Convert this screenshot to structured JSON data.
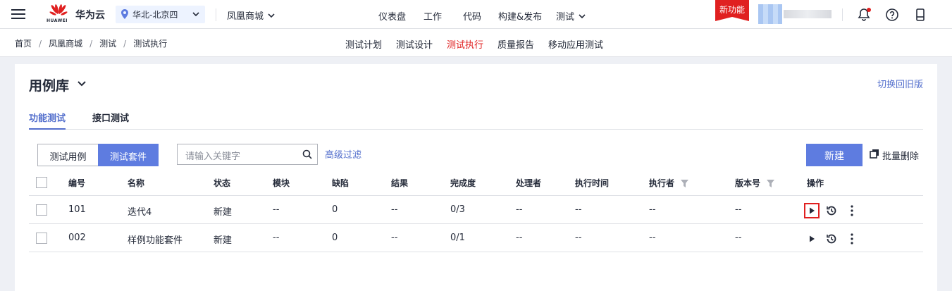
{
  "header": {
    "logo_text": "HUAWEI",
    "brand": "华为云",
    "region": "华北-北京四",
    "project": "凤凰商城",
    "nav": [
      "仪表盘",
      "工作",
      "代码",
      "构建&发布",
      "测试"
    ],
    "new_feature": "新功能"
  },
  "subheader": {
    "breadcrumb": [
      "首页",
      "凤凰商城",
      "测试",
      "测试执行"
    ],
    "tabs": [
      "测试计划",
      "测试设计",
      "测试执行",
      "质量报告",
      "移动应用测试"
    ],
    "active_tab": "测试执行"
  },
  "page": {
    "title": "用例库",
    "switch_old": "切换回旧版",
    "tabs": [
      "功能测试",
      "接口测试"
    ],
    "segment": [
      "测试用例",
      "测试套件"
    ],
    "search_placeholder": "请输入关键字",
    "advanced_filter": "高级过滤",
    "new_button": "新建",
    "bulk_delete": "批量删除"
  },
  "table": {
    "columns": [
      "编号",
      "名称",
      "状态",
      "模块",
      "缺陷",
      "结果",
      "完成度",
      "处理者",
      "执行时间",
      "执行者",
      "版本号",
      "操作"
    ],
    "rows": [
      [
        "101",
        "迭代4",
        "新建",
        "--",
        "0",
        "--",
        "0/3",
        "--",
        "--",
        "--",
        "--"
      ],
      [
        "002",
        "样例功能套件",
        "新建",
        "--",
        "0",
        "--",
        "0/1",
        "--",
        "--",
        "--",
        "--"
      ]
    ]
  },
  "colors": {
    "accent": "#5e7ce0",
    "link": "#526ecc",
    "danger": "#e02020"
  }
}
